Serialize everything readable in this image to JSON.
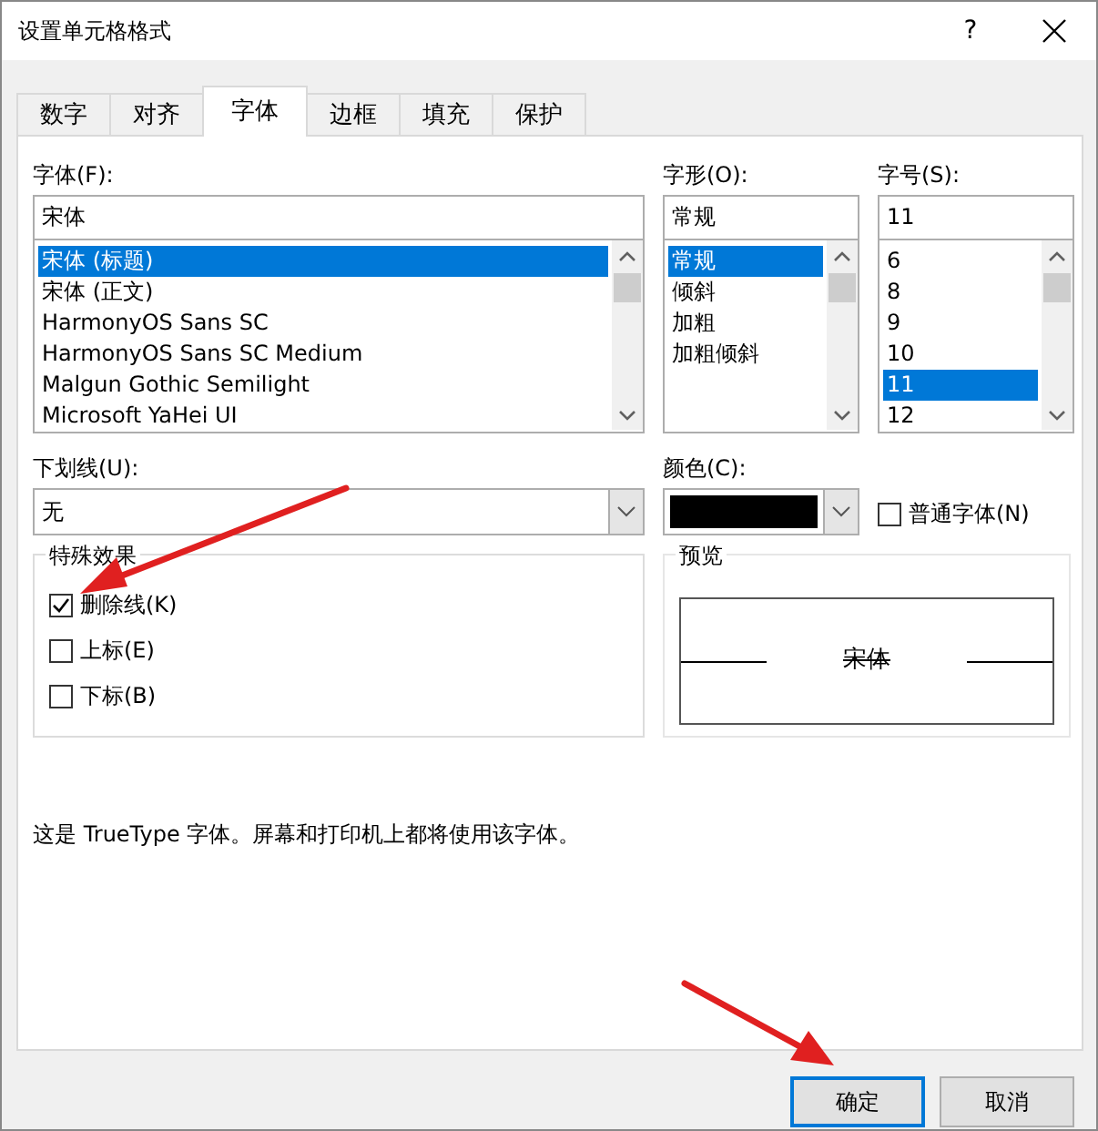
{
  "window": {
    "title": "设置单元格格式",
    "help": "?"
  },
  "tabs": [
    {
      "label": "数字",
      "selected": false
    },
    {
      "label": "对齐",
      "selected": false
    },
    {
      "label": "字体",
      "selected": true
    },
    {
      "label": "边框",
      "selected": false
    },
    {
      "label": "填充",
      "selected": false
    },
    {
      "label": "保护",
      "selected": false
    }
  ],
  "font": {
    "label": "字体(F):",
    "value": "宋体",
    "items": [
      {
        "label": "宋体 (标题)",
        "selected": true
      },
      {
        "label": "宋体 (正文)",
        "selected": false
      },
      {
        "label": "HarmonyOS Sans SC",
        "selected": false
      },
      {
        "label": "HarmonyOS Sans SC Medium",
        "selected": false
      },
      {
        "label": "Malgun Gothic Semilight",
        "selected": false
      },
      {
        "label": "Microsoft YaHei UI",
        "selected": false
      }
    ]
  },
  "style": {
    "label": "字形(O):",
    "value": "常规",
    "items": [
      {
        "label": "常规",
        "selected": true
      },
      {
        "label": "倾斜",
        "selected": false
      },
      {
        "label": "加粗",
        "selected": false
      },
      {
        "label": "加粗倾斜",
        "selected": false
      }
    ]
  },
  "size": {
    "label": "字号(S):",
    "value": "11",
    "items": [
      {
        "label": "6",
        "selected": false
      },
      {
        "label": "8",
        "selected": false
      },
      {
        "label": "9",
        "selected": false
      },
      {
        "label": "10",
        "selected": false
      },
      {
        "label": "11",
        "selected": true
      },
      {
        "label": "12",
        "selected": false
      }
    ]
  },
  "underline": {
    "label": "下划线(U):",
    "value": "无"
  },
  "color": {
    "label": "颜色(C):"
  },
  "normal_font": {
    "label": "普通字体(N)",
    "checked": false
  },
  "effects": {
    "title": "特殊效果",
    "items": [
      {
        "label": "删除线(K)",
        "checked": true
      },
      {
        "label": "上标(E)",
        "checked": false
      },
      {
        "label": "下标(B)",
        "checked": false
      }
    ]
  },
  "preview": {
    "title": "预览",
    "text": "宋体"
  },
  "description": "这是 TrueType 字体。屏幕和打印机上都将使用该字体。",
  "buttons": [
    {
      "label": "确定",
      "default": true
    },
    {
      "label": "取消",
      "default": false
    }
  ]
}
